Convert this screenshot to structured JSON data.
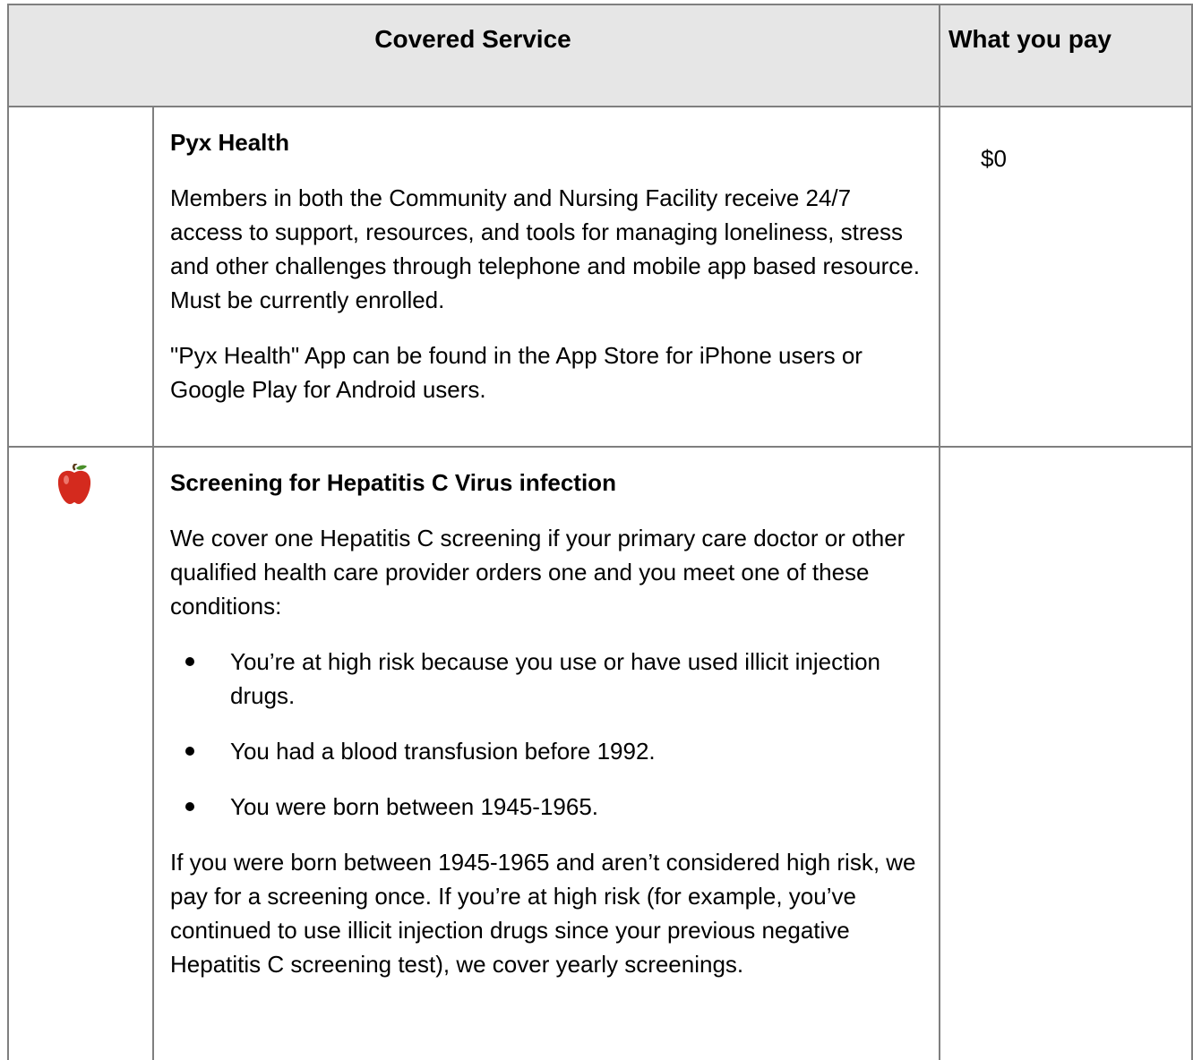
{
  "header": {
    "covered_service": "Covered Service",
    "what_you_pay": "What you pay"
  },
  "rows": [
    {
      "title": "Pyx Health",
      "paragraphs": [
        "Members in both the Community and Nursing Facility receive 24/7 access to support, resources, and tools for managing loneliness, stress and other challenges through telephone and mobile app based resource. Must be currently enrolled.",
        "\"Pyx Health\" App can be found in the App Store for iPhone users or Google Play for Android users."
      ],
      "pay": "$0"
    },
    {
      "icon": "apple-icon",
      "title": "Screening for Hepatitis C Virus infection",
      "intro": "We cover one Hepatitis C screening if your primary care doctor or other qualified health care provider orders one and you meet one of these conditions:",
      "bullets": [
        "You’re at high risk because you use or have used illicit injection drugs.",
        "You had a blood transfusion before 1992.",
        "You were born between 1945-1965."
      ],
      "closing": "If you were born between 1945-1965 and aren’t considered high risk, we pay for a screening once. If you’re at high risk (for example, you’ve continued to use illicit injection drugs since your previous negative Hepatitis C screening test), we cover yearly screenings.",
      "pay": ""
    }
  ],
  "colors": {
    "header_bg": "#e6e6e6",
    "border": "#7f7f7f",
    "apple_red": "#d42a1e"
  }
}
